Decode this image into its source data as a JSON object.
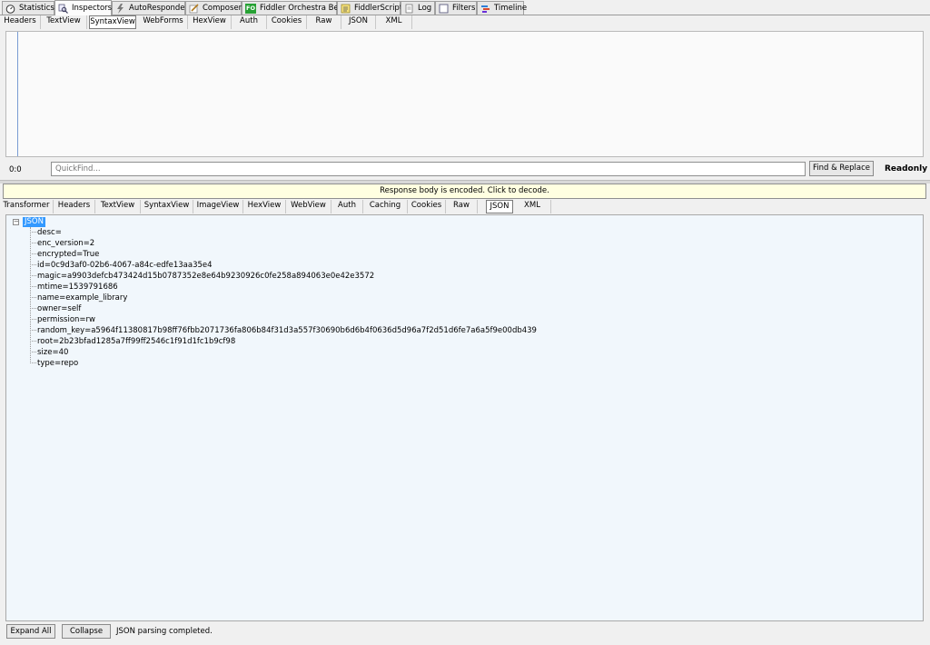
{
  "main_tabs": [
    {
      "label": "Statistics",
      "icon": "stopwatch-icon"
    },
    {
      "label": "Inspectors",
      "icon": "magnifier-icon",
      "active": true
    },
    {
      "label": "AutoResponder",
      "icon": "lightning-icon"
    },
    {
      "label": "Composer",
      "icon": "pencil-icon"
    },
    {
      "label": "Fiddler Orchestra Beta",
      "icon": "fo-icon",
      "icon_text": "FO"
    },
    {
      "label": "FiddlerScript",
      "icon": "script-icon"
    },
    {
      "label": "Log",
      "icon": "log-icon"
    },
    {
      "label": "Filters",
      "icon": "checkbox-icon"
    },
    {
      "label": "Timeline",
      "icon": "timeline-icon"
    }
  ],
  "request_tabs": [
    "Headers",
    "TextView",
    "SyntaxView",
    "WebForms",
    "HexView",
    "Auth",
    "Cookies",
    "Raw",
    "JSON",
    "XML"
  ],
  "request_active_tab": "SyntaxView",
  "editor": {
    "position": "0:0",
    "quickfind_placeholder": "QuickFind...",
    "find_replace_label": "Find & Replace",
    "readonly_label": "Readonly"
  },
  "encoded_notice": "Response body is encoded. Click to decode.",
  "response_tabs": [
    "Transformer",
    "Headers",
    "TextView",
    "SyntaxView",
    "ImageView",
    "HexView",
    "WebView",
    "Auth",
    "Caching",
    "Cookies",
    "Raw",
    "JSON",
    "XML"
  ],
  "response_active_tab": "JSON",
  "tree": {
    "root": "JSON",
    "toggle": "−",
    "nodes": [
      "desc=",
      "enc_version=2",
      "encrypted=True",
      "id=0c9d3af0-02b6-4067-a84c-edfe13aa35e4",
      "magic=a9903defcb473424d15b0787352e8e64b9230926c0fe258a894063e0e42e3572",
      "mtime=1539791686",
      "name=example_library",
      "owner=self",
      "permission=rw",
      "random_key=a5964f11380817b98ff76fbb2071736fa806b84f31d3a557f30690b6d6b4f0636d5d96a7f2d51d6fe7a6a5f9e00db439",
      "root=2b23bfad1285a7ff99ff2546c1f91d1fc1b9cf98",
      "size=40",
      "type=repo"
    ]
  },
  "bottom": {
    "expand_all_label": "Expand All",
    "collapse_label": "Collapse",
    "status": "JSON parsing completed."
  }
}
